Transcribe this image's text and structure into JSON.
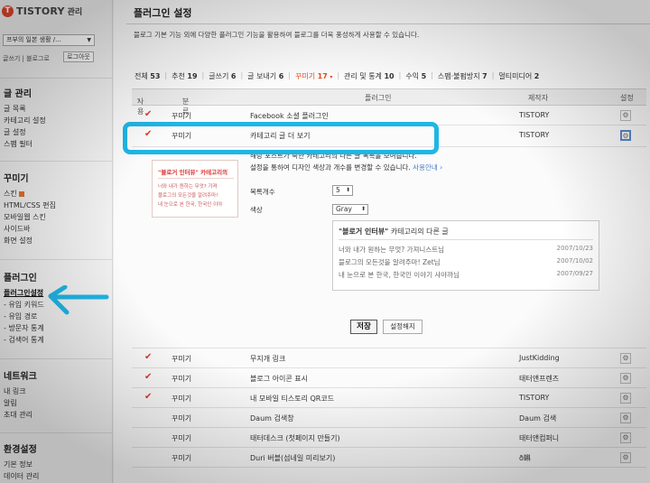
{
  "sidebar": {
    "brand_icon": "T",
    "brand_name": "TISTORY",
    "brand_sub": "관리",
    "blog_select": "프부의 일본 생활 /...",
    "quick_links": "글쓰기 | 블로그로",
    "logout": "로그아웃",
    "groups": [
      {
        "head": "글 관리",
        "items": [
          "글 목록",
          "카테고리 설정",
          "글 설정",
          "스팸 필터"
        ]
      },
      {
        "head": "꾸미기",
        "items": [
          "스킨",
          "HTML/CSS 편집",
          "모바일웹 스킨",
          "사이드바",
          "화면 설정"
        ]
      },
      {
        "head": "플러그인",
        "items": [
          "플러그인설정",
          "유입 키워드",
          "유입 경로",
          "방문자 통계",
          "검색어 통계"
        ]
      },
      {
        "head": "네트워크",
        "items": [
          "내 링크",
          "알림",
          "초대 관리"
        ]
      },
      {
        "head": "환경설정",
        "items": [
          "기본 정보",
          "데이터 관리"
        ]
      }
    ]
  },
  "main": {
    "title": "플러그인 설정",
    "description": "블로그 기본 기능 외에 다양한 플러그인 기능을 활용하여 블로그를 더욱 풍성하게 사용할 수 있습니다.",
    "filter_tabs": [
      {
        "label": "전체",
        "count": "53"
      },
      {
        "label": "추천",
        "count": "19"
      },
      {
        "label": "글쓰기",
        "count": "6"
      },
      {
        "label": "글 보내기",
        "count": "6"
      },
      {
        "label": "꾸미기",
        "count": "17"
      },
      {
        "label": "관리 및 통계",
        "count": "10"
      },
      {
        "label": "수익",
        "count": "5"
      },
      {
        "label": "스팸·불펌방지",
        "count": "7"
      },
      {
        "label": "멀티미디어",
        "count": "2"
      }
    ],
    "table_headers": {
      "use": "사용",
      "category": "분류",
      "plugin": "플러그인",
      "maker": "제작자",
      "settings": "설정"
    },
    "rows_top": [
      {
        "checked": true,
        "category": "꾸미기",
        "name": "Facebook 소셜 플러그인",
        "maker": "TISTORY"
      },
      {
        "checked": true,
        "category": "꾸미기",
        "name": "카테고리 글 더 보기",
        "maker": "TISTORY"
      }
    ],
    "detail": {
      "thumb_title": "\"블로거 인터뷰\" 카테고리의",
      "thumb_lines": [
        "너와 내가 원하는 무엇? 가져",
        "블로그의 모든것을 알려주마!",
        "내 눈으로 본 한국, 한국인 이야"
      ],
      "desc1": "해당 포스트가 속한 카테고리의 다른 글 목록을 보여줍니다.",
      "desc2": "설정을 통하여 디자인 색상과 개수를 변경할 수 있습니다.",
      "help_link": "사용안내 ›",
      "count_label": "목록개수",
      "count_value": "5",
      "color_label": "색상",
      "color_value": "Gray",
      "sample_title_quote": "\"블로거 인터뷰\"",
      "sample_title_rest": " 카테고리의 다른 글",
      "sample_items": [
        {
          "title": "너와 내가 원하는 무엇? 가져니스트님",
          "date": "2007/10/23"
        },
        {
          "title": "블로그의 모든것을 알려주마! Zet님",
          "date": "2007/10/02"
        },
        {
          "title": "내 눈으로 본 한국, 한국인 이야기 샤야까님",
          "date": "2007/09/27"
        }
      ],
      "save_label": "저장",
      "reset_label": "설정해지"
    },
    "rows_bottom": [
      {
        "checked": true,
        "category": "꾸미기",
        "name": "무지개 링크",
        "maker": "JustKidding"
      },
      {
        "checked": true,
        "category": "꾸미기",
        "name": "블로그 아이콘 표시",
        "maker": "태터앤프렌즈"
      },
      {
        "checked": true,
        "category": "꾸미기",
        "name": "내 모바일 티스토리 QR코드",
        "maker": "TISTORY"
      },
      {
        "checked": false,
        "category": "꾸미기",
        "name": "Daum 검색창",
        "maker": "Daum 검색"
      },
      {
        "checked": false,
        "category": "꾸미기",
        "name": "태터데스크 (첫페이지 만들기)",
        "maker": "태터앤컴퍼니"
      },
      {
        "checked": false,
        "category": "꾸미기",
        "name": "Duri 버블(섬네일 미리보기)",
        "maker": "ð蝌"
      }
    ]
  },
  "colors": {
    "accent": "#e24a1e",
    "highlight": "#1fb6e6",
    "check": "#d93a2b"
  }
}
